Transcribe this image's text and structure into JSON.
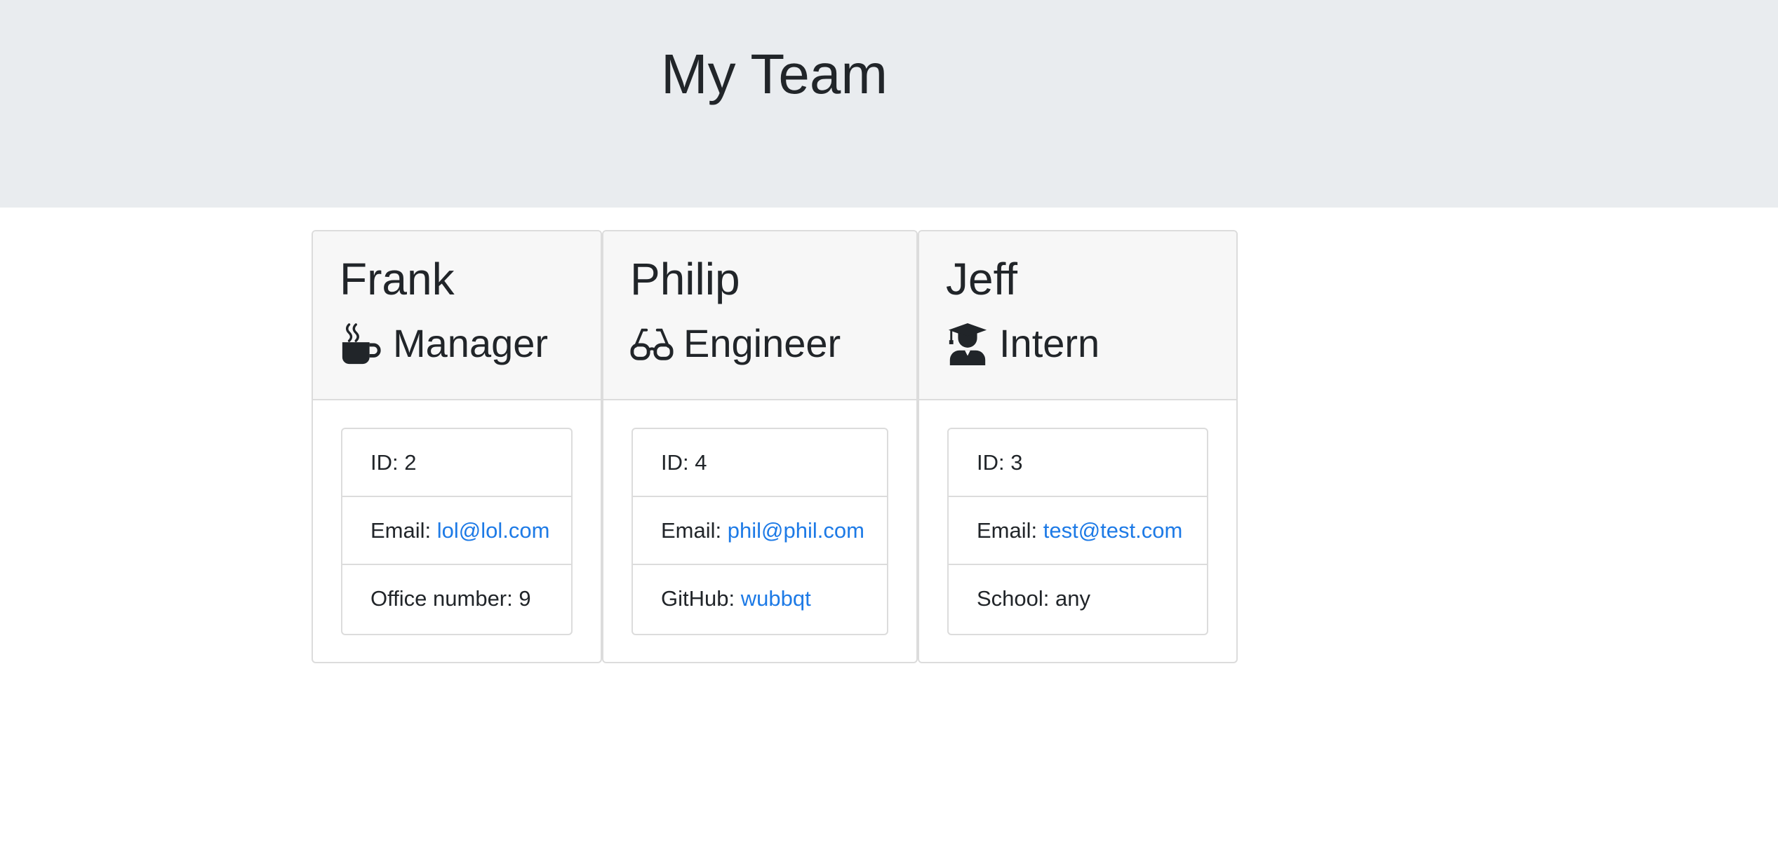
{
  "header": {
    "title": "My Team"
  },
  "colors": {
    "header_bg": "#e9ecef",
    "card_header_bg": "#f7f7f7",
    "link": "#1d7ae6",
    "text": "#212529",
    "border": "#dcdcdc"
  },
  "cards": [
    {
      "name": "Frank",
      "role": "Manager",
      "icon": "coffee-mug-icon",
      "id_label": "ID: 2",
      "email_label": "Email: ",
      "email": "lol@lol.com",
      "extra_label": "Office number: 9"
    },
    {
      "name": "Philip",
      "role": "Engineer",
      "icon": "glasses-icon",
      "id_label": "ID: 4",
      "email_label": "Email: ",
      "email": "phil@phil.com",
      "extra_label": "GitHub: ",
      "extra_link": "wubbqt"
    },
    {
      "name": "Jeff",
      "role": "Intern",
      "icon": "graduate-icon",
      "id_label": "ID: 3",
      "email_label": "Email: ",
      "email": "test@test.com",
      "extra_label": "School: any"
    }
  ]
}
